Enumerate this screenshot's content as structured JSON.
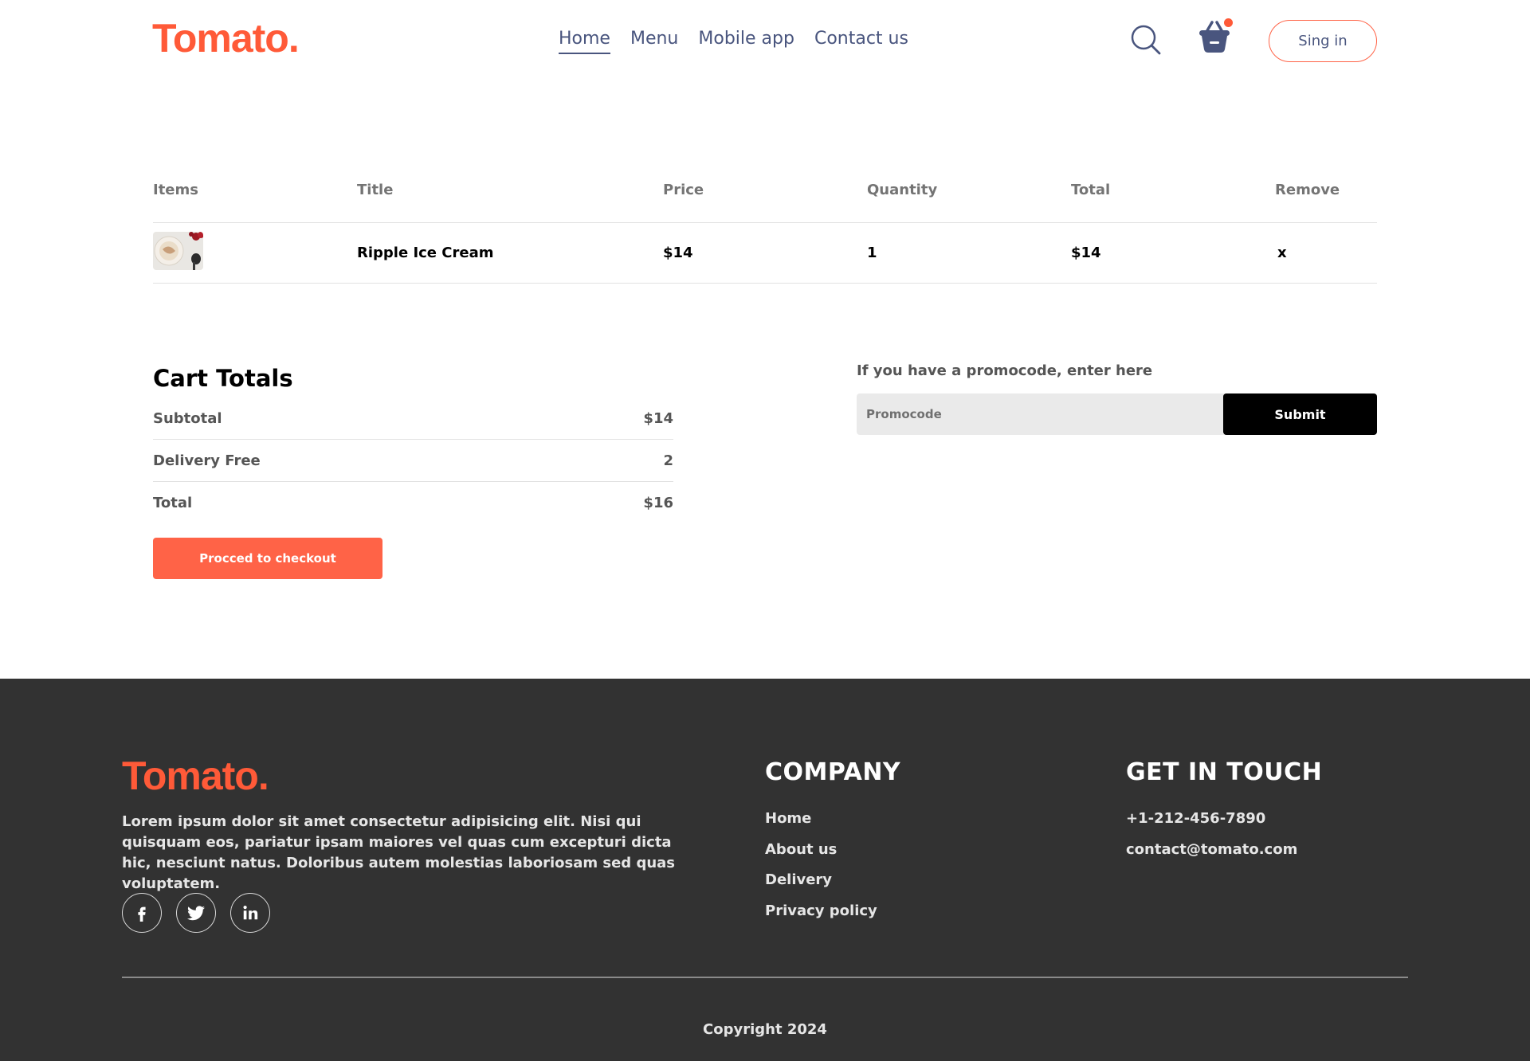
{
  "navbar": {
    "logo": "Tomato.",
    "menu": [
      {
        "label": "Home",
        "active": true
      },
      {
        "label": "Menu",
        "active": false
      },
      {
        "label": "Mobile app",
        "active": false
      },
      {
        "label": "Contact us",
        "active": false
      }
    ],
    "search_icon": "search-icon",
    "basket_icon": "basket-icon",
    "signin_label": "Sing in",
    "accent_color": "#ff5a38"
  },
  "cart": {
    "headers": [
      "Items",
      "Title",
      "Price",
      "Quantity",
      "Total",
      "Remove"
    ],
    "items": [
      {
        "image": "ice-cream-thumbnail",
        "title": "Ripple Ice Cream",
        "price": "$14",
        "quantity": "1",
        "total": "$14",
        "remove": "x"
      }
    ]
  },
  "totals": {
    "title": "Cart Totals",
    "subtotal_label": "Subtotal",
    "subtotal_value": "$14",
    "delivery_label": "Delivery Free",
    "delivery_value": "2",
    "total_label": "Total",
    "total_value": "$16",
    "checkout_label": "Procced to checkout"
  },
  "promo": {
    "label": "If you have a promocode, enter here",
    "placeholder": "Promocode",
    "value": "",
    "submit_label": "Submit"
  },
  "footer": {
    "logo": "Tomato.",
    "description": "Lorem ipsum dolor sit amet consectetur adipisicing elit. Nisi qui quisquam eos, pariatur ipsam maiores vel quas cum excepturi dicta hic, nesciunt natus. Doloribus autem molestias laboriosam sed quas voluptatem.",
    "socials": [
      "facebook-icon",
      "twitter-icon",
      "linkedin-icon"
    ],
    "company_title": "COMPANY",
    "company_links": [
      "Home",
      "About us",
      "Delivery",
      "Privacy policy"
    ],
    "contact_title": "GET IN TOUCH",
    "phone": "+1-212-456-7890",
    "email": "contact@tomato.com",
    "copyright": "Copyright 2024",
    "background": "#323232"
  }
}
